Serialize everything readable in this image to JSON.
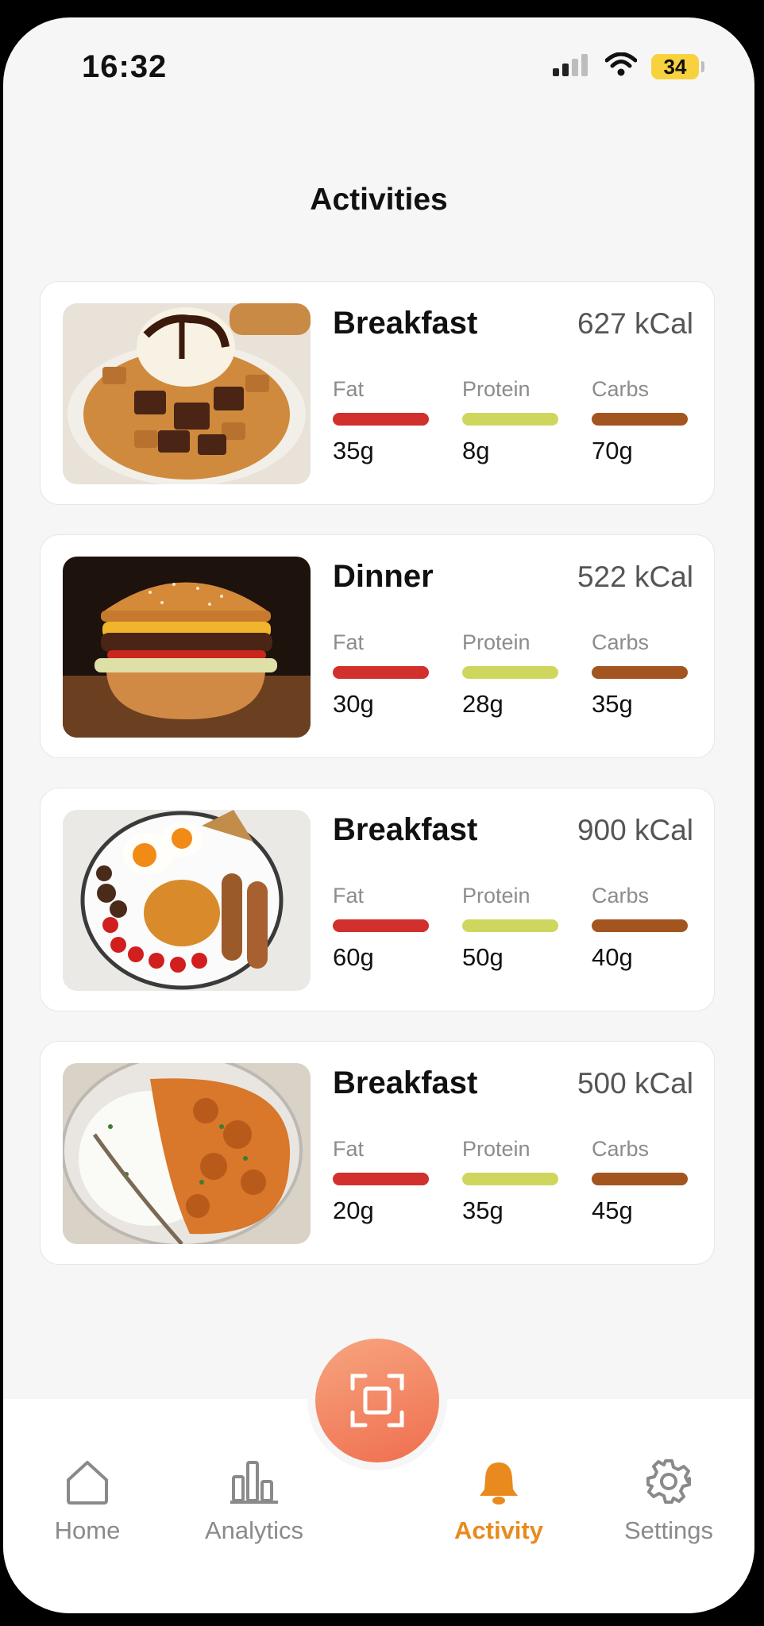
{
  "status_bar": {
    "time": "16:32",
    "battery": "34"
  },
  "header": {
    "title": "Activities"
  },
  "labels": {
    "fat": "Fat",
    "protein": "Protein",
    "carbs": "Carbs"
  },
  "activities": [
    {
      "meal": "Breakfast",
      "kcal": "627 kCal",
      "fat": "35g",
      "protein": "8g",
      "carbs": "70g",
      "image": "waffle-ice-cream-photo"
    },
    {
      "meal": "Dinner",
      "kcal": "522 kCal",
      "fat": "30g",
      "protein": "28g",
      "carbs": "35g",
      "image": "burger-photo"
    },
    {
      "meal": "Breakfast",
      "kcal": "900 kCal",
      "fat": "60g",
      "protein": "50g",
      "carbs": "40g",
      "image": "full-english-breakfast-photo"
    },
    {
      "meal": "Breakfast",
      "kcal": "500 kCal",
      "fat": "20g",
      "protein": "35g",
      "carbs": "45g",
      "image": "curry-rice-photo"
    }
  ],
  "tab_bar": {
    "items": [
      {
        "label": "Home",
        "icon": "home-icon"
      },
      {
        "label": "Analytics",
        "icon": "analytics-icon"
      },
      {
        "label": "Activity",
        "icon": "bell-icon",
        "active": true
      },
      {
        "label": "Settings",
        "icon": "gear-icon"
      }
    ],
    "scan_icon": "scan-icon"
  },
  "colors": {
    "fat": "#d1302d",
    "protein": "#cfd65e",
    "carbs": "#a3551f",
    "accent": "#e88a1e",
    "fab": "#ef7a5a"
  }
}
